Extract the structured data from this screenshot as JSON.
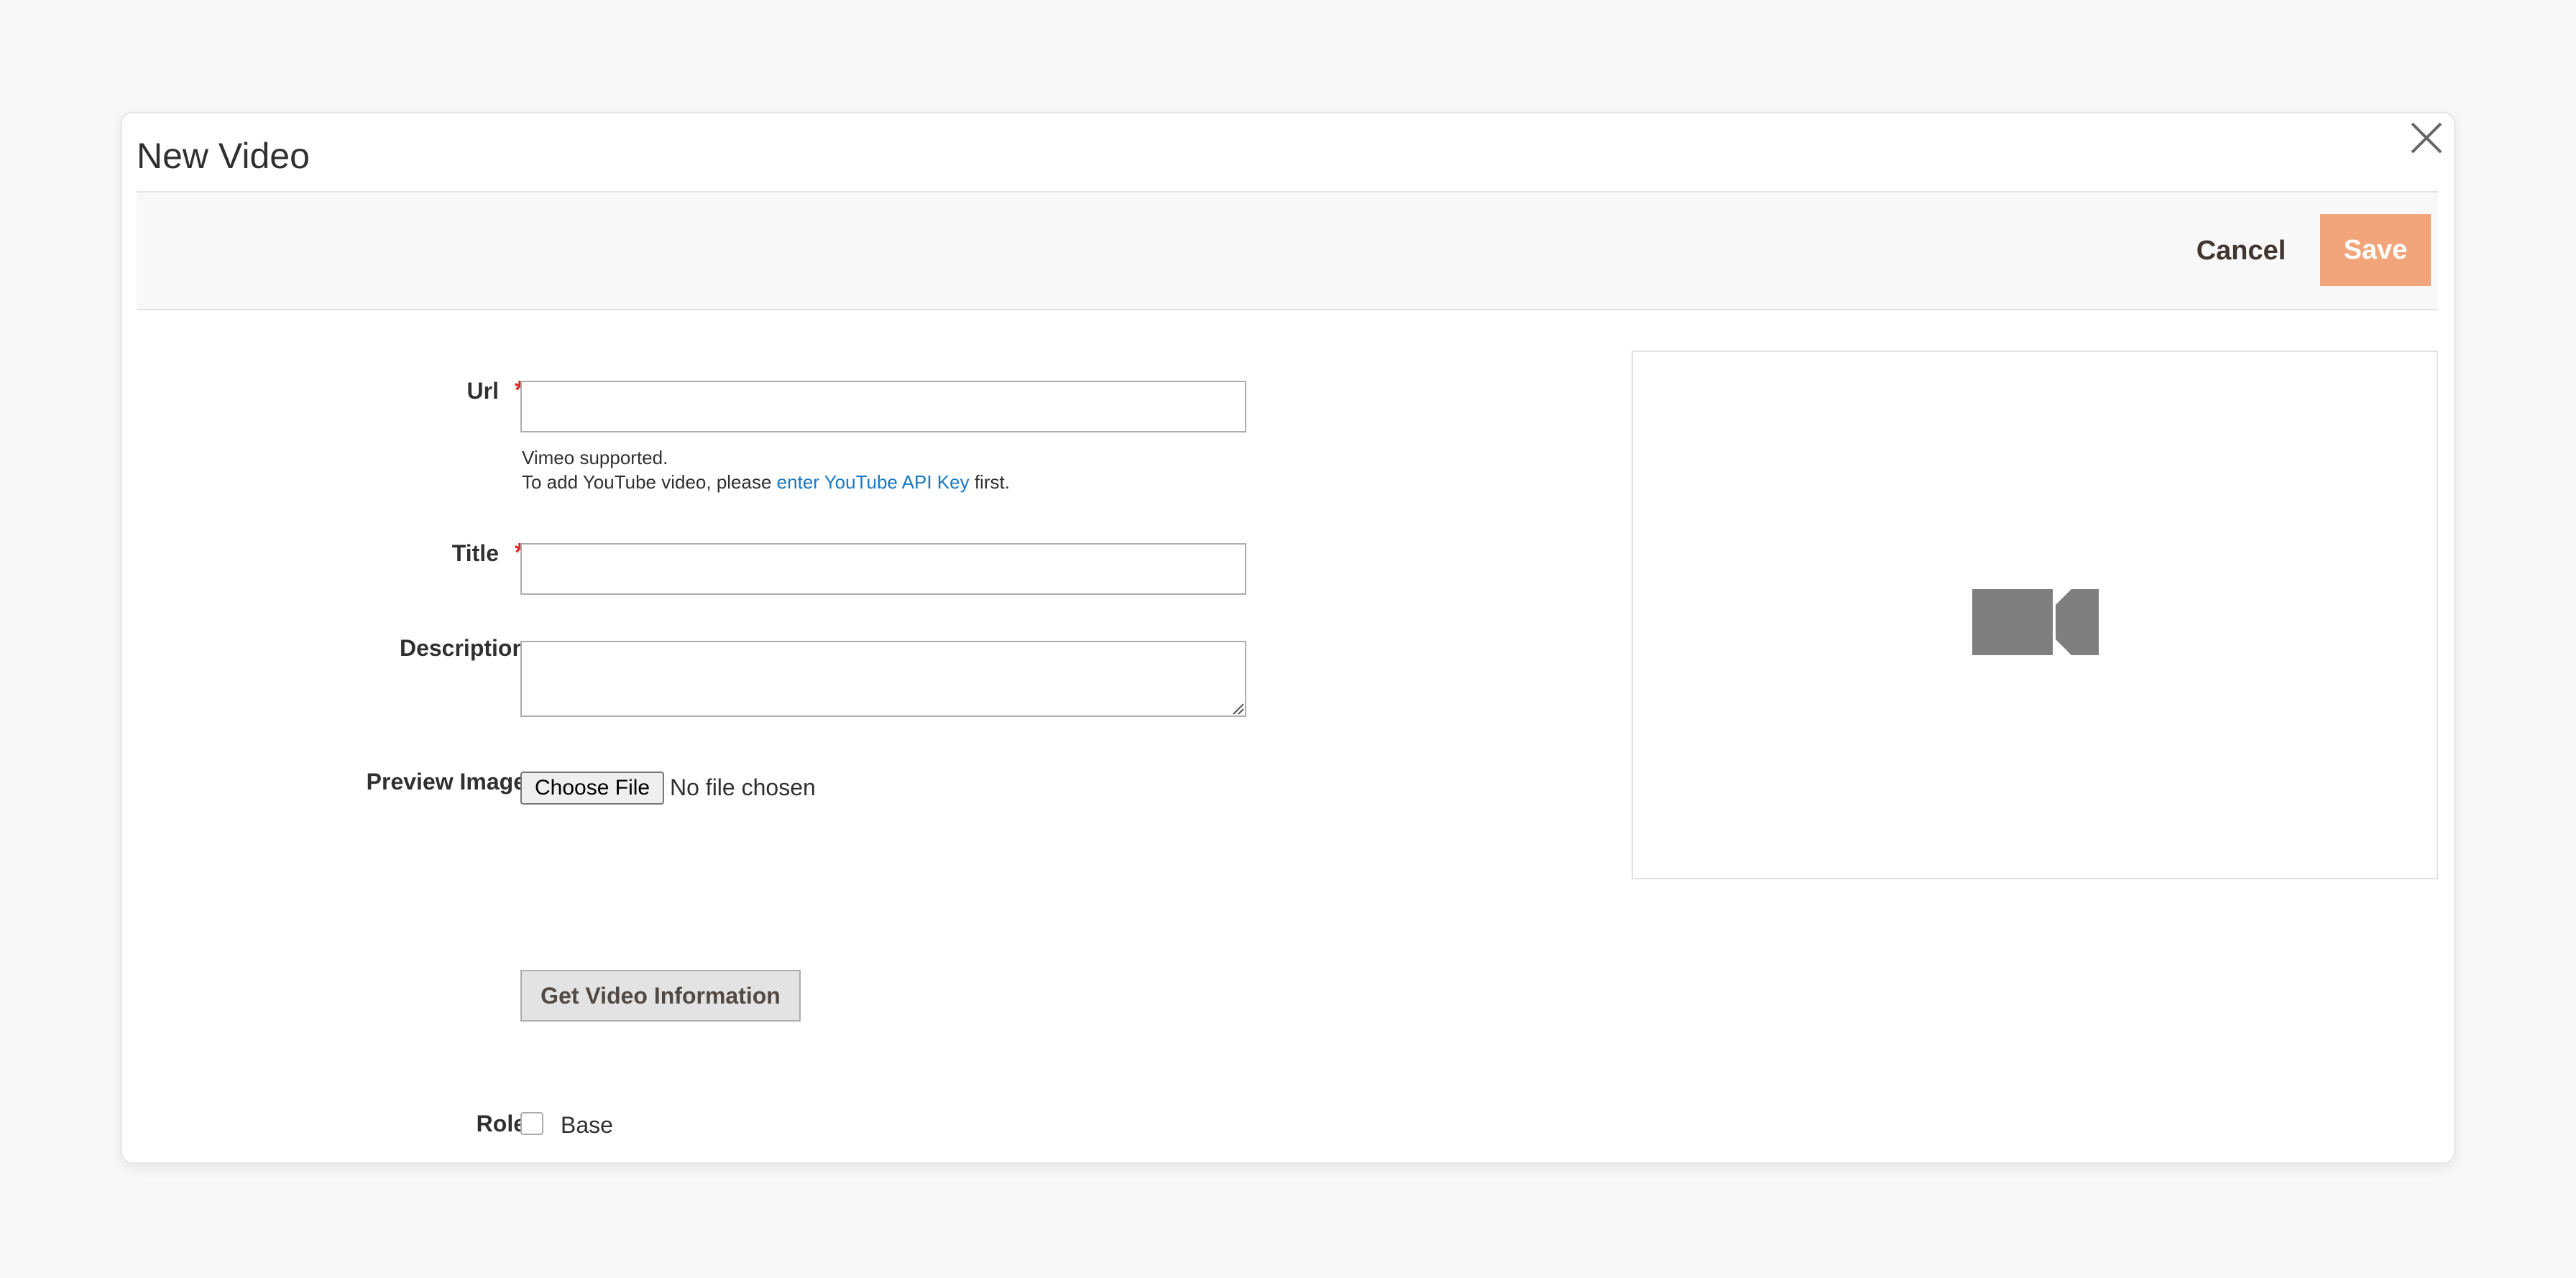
{
  "modal": {
    "title": "New Video",
    "close_icon": "close-icon"
  },
  "actions": {
    "cancel_label": "Cancel",
    "save_label": "Save"
  },
  "form": {
    "url": {
      "label": "Url",
      "required_mark": "*",
      "value": "",
      "note_line1": "Vimeo supported.",
      "note_line2_prefix": "To add YouTube video, please",
      "note_link": "enter YouTube API Key",
      "note_line2_suffix": "first."
    },
    "title": {
      "label": "Title",
      "required_mark": "*",
      "value": ""
    },
    "description": {
      "label": "Description",
      "value": ""
    },
    "preview_image": {
      "label": "Preview Image",
      "choose_label": "Choose File",
      "status": "No file chosen"
    },
    "get_info_label": "Get Video Information",
    "role": {
      "label": "Role",
      "option_label": "Base",
      "checked": false
    }
  },
  "preview": {
    "icon": "video-camera-icon"
  },
  "colors": {
    "accent": "#f2a57a",
    "link": "#1979c3",
    "required": "#e22626"
  }
}
